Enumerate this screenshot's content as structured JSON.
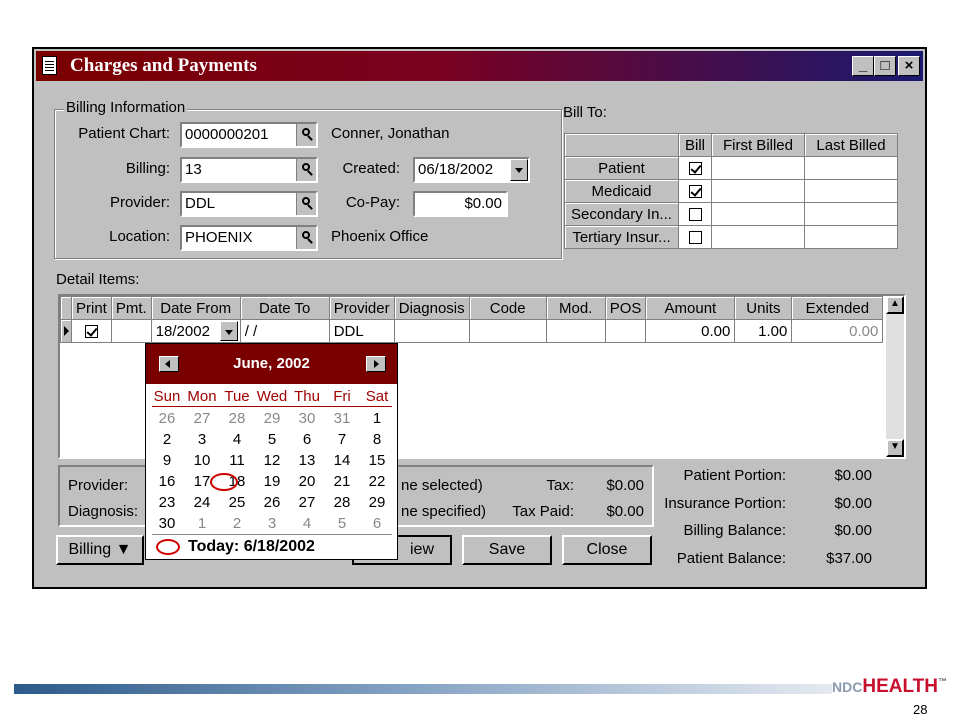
{
  "window": {
    "title": "Charges and Payments",
    "min": "_",
    "max": "□",
    "close": "×"
  },
  "billing_info": {
    "group_label": "Billing Information",
    "patient_chart_label": "Patient Chart:",
    "patient_chart": "0000000201",
    "patient_name": "Conner, Jonathan",
    "billing_label": "Billing:",
    "billing": "13",
    "created_label": "Created:",
    "created": "06/18/2002",
    "provider_label": "Provider:",
    "provider": "DDL",
    "copay_label": "Co-Pay:",
    "copay": "$0.00",
    "location_label": "Location:",
    "location": "PHOENIX",
    "location_name": "Phoenix Office"
  },
  "bill_to": {
    "label": "Bill To:",
    "columns": [
      "Bill",
      "First Billed",
      "Last Billed"
    ],
    "rows": [
      {
        "name": "Patient",
        "checked": true
      },
      {
        "name": "Medicaid",
        "checked": true
      },
      {
        "name": "Secondary In...",
        "checked": false
      },
      {
        "name": "Tertiary Insur...",
        "checked": false
      }
    ]
  },
  "detail": {
    "label": "Detail Items:",
    "columns": [
      "Print",
      "Pmt.",
      "Date From",
      "Date To",
      "Provider",
      "Diagnosis",
      "Code",
      "Mod.",
      "POS",
      "Amount",
      "Units",
      "Extended"
    ],
    "row": {
      "date_from": "18/2002",
      "date_to": "/ /",
      "provider": "DDL",
      "amount": "0.00",
      "units": "1.00",
      "extended": "0.00"
    }
  },
  "lower": {
    "provider_label": "Provider:",
    "diagnosis_label": "Diagnosis:",
    "provider_note": "ne selected)",
    "diagnosis_note": "ne specified)",
    "tax_label": "Tax:",
    "tax": "$0.00",
    "tax_paid_label": "Tax Paid:",
    "tax_paid": "$0.00"
  },
  "balances": [
    {
      "label": "Patient Portion:",
      "value": "$0.00"
    },
    {
      "label": "Insurance Portion:",
      "value": "$0.00"
    },
    {
      "label": "Billing Balance:",
      "value": "$0.00"
    },
    {
      "label": "Patient Balance:",
      "value": "$37.00"
    }
  ],
  "buttons": {
    "billing": "Billing",
    "view": "iew",
    "save": "Save",
    "close": "Close"
  },
  "calendar": {
    "month": "June, 2002",
    "dow": [
      "Sun",
      "Mon",
      "Tue",
      "Wed",
      "Thu",
      "Fri",
      "Sat"
    ],
    "weeks": [
      [
        "26",
        "27",
        "28",
        "29",
        "30",
        "31",
        "1"
      ],
      [
        "2",
        "3",
        "4",
        "5",
        "6",
        "7",
        "8"
      ],
      [
        "9",
        "10",
        "11",
        "12",
        "13",
        "14",
        "15"
      ],
      [
        "16",
        "17",
        "18",
        "19",
        "20",
        "21",
        "22"
      ],
      [
        "23",
        "24",
        "25",
        "26",
        "27",
        "28",
        "29"
      ],
      [
        "30",
        "1",
        "2",
        "3",
        "4",
        "5",
        "6"
      ]
    ],
    "today_text": "Today: 6/18/2002"
  },
  "footer": {
    "brand_prefix": "NDC",
    "brand": "HEALTH",
    "tm": "™",
    "page": "28"
  },
  "colors": {
    "title_left": "#7a0000",
    "title_right": "#1a1a70",
    "calendar_header": "#7a0000",
    "dow": "#a00000",
    "today_mark": "#d00000"
  }
}
